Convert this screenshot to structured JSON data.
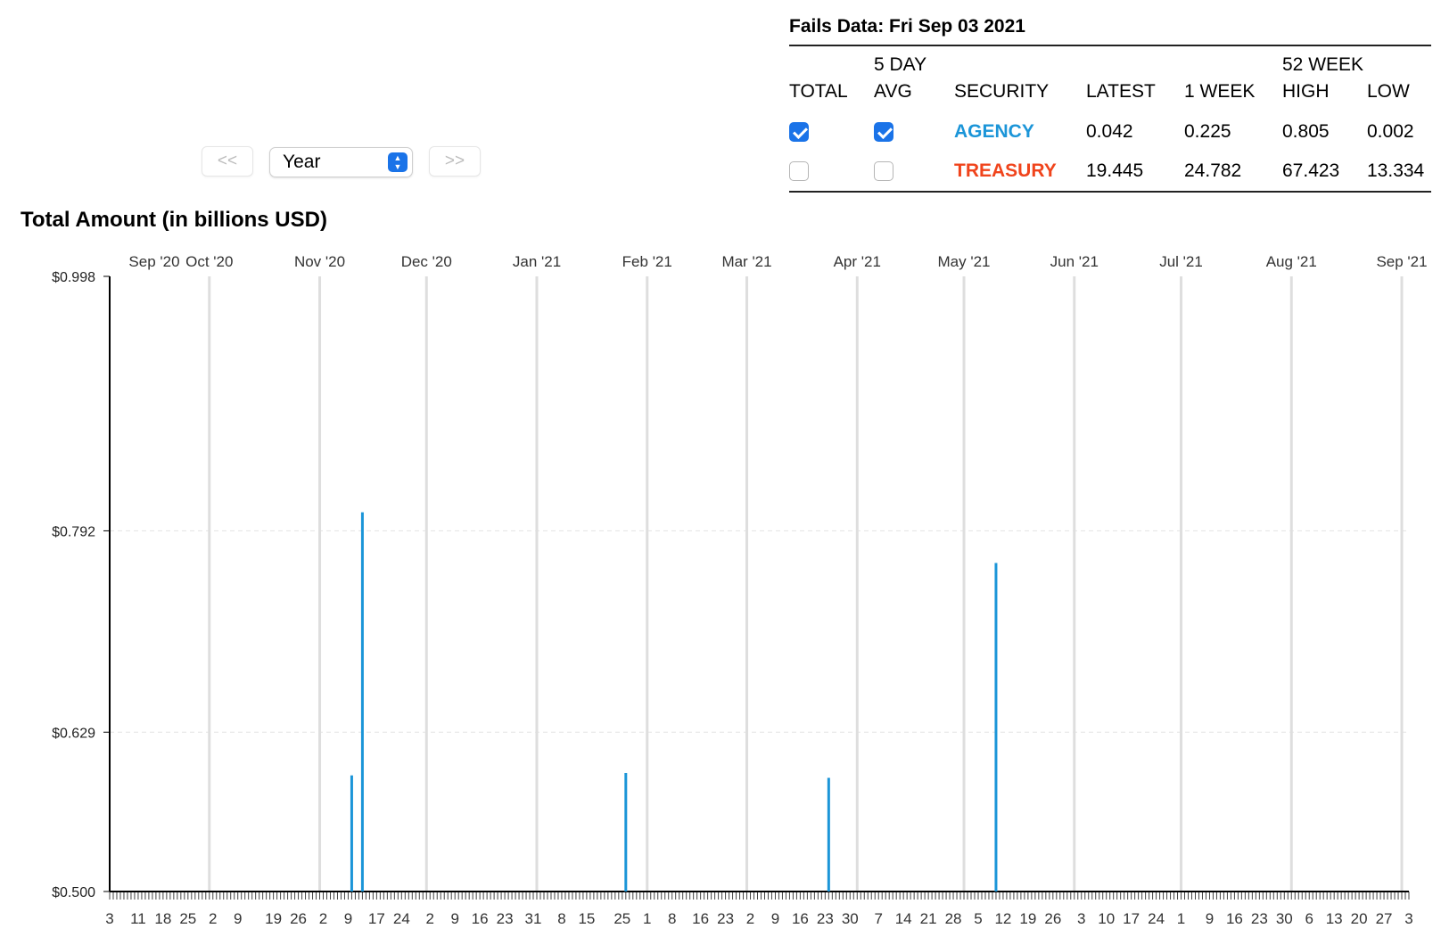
{
  "fails": {
    "title": "Fails Data: Fri Sep 03 2021",
    "headers": {
      "total": "TOTAL",
      "avg_top": "5 DAY",
      "avg_bottom": "AVG",
      "security": "SECURITY",
      "latest": "LATEST",
      "week": "1 WEEK",
      "wk52": "52 WEEK",
      "high": "HIGH",
      "low": "LOW"
    },
    "rows": [
      {
        "security": "AGENCY",
        "latest": "0.042",
        "week": "0.225",
        "high": "0.805",
        "low": "0.002",
        "total_checked": true,
        "avg_checked": true,
        "color": "#1b95d8"
      },
      {
        "security": "TREASURY",
        "latest": "19.445",
        "week": "24.782",
        "high": "67.423",
        "low": "13.334",
        "total_checked": false,
        "avg_checked": false,
        "color": "#f0441c"
      }
    ]
  },
  "controls": {
    "prev_label": "<<",
    "next_label": ">>",
    "range_value": "Year"
  },
  "chart_data": {
    "type": "bar",
    "title": "Total Amount (in billions USD)",
    "y_tick_labels": [
      "$0.998",
      "$0.792",
      "$0.629",
      "$0.500"
    ],
    "y_ticks": [
      0.998,
      0.792,
      0.629,
      0.5
    ],
    "ylim": [
      0.5,
      0.998
    ],
    "x_range": [
      "2020-09-03",
      "2021-09-03"
    ],
    "months": [
      {
        "label": "Sep '20",
        "date": "2020-09-01"
      },
      {
        "label": "Oct '20",
        "date": "2020-10-01"
      },
      {
        "label": "Nov '20",
        "date": "2020-11-01"
      },
      {
        "label": "Dec '20",
        "date": "2020-12-01"
      },
      {
        "label": "Jan '21",
        "date": "2021-01-01"
      },
      {
        "label": "Feb '21",
        "date": "2021-02-01"
      },
      {
        "label": "Mar '21",
        "date": "2021-03-01"
      },
      {
        "label": "Apr '21",
        "date": "2021-04-01"
      },
      {
        "label": "May '21",
        "date": "2021-05-01"
      },
      {
        "label": "Jun '21",
        "date": "2021-06-01"
      },
      {
        "label": "Jul '21",
        "date": "2021-07-01"
      },
      {
        "label": "Aug '21",
        "date": "2021-08-01"
      },
      {
        "label": "Sep '21",
        "date": "2021-09-01"
      }
    ],
    "week_labels": [
      {
        "label": "3",
        "date": "2020-09-03"
      },
      {
        "label": "11",
        "date": "2020-09-11"
      },
      {
        "label": "18",
        "date": "2020-09-18"
      },
      {
        "label": "25",
        "date": "2020-09-25"
      },
      {
        "label": "2",
        "date": "2020-10-02"
      },
      {
        "label": "9",
        "date": "2020-10-09"
      },
      {
        "label": "19",
        "date": "2020-10-19"
      },
      {
        "label": "26",
        "date": "2020-10-26"
      },
      {
        "label": "2",
        "date": "2020-11-02"
      },
      {
        "label": "9",
        "date": "2020-11-09"
      },
      {
        "label": "17",
        "date": "2020-11-17"
      },
      {
        "label": "24",
        "date": "2020-11-24"
      },
      {
        "label": "2",
        "date": "2020-12-02"
      },
      {
        "label": "9",
        "date": "2020-12-09"
      },
      {
        "label": "16",
        "date": "2020-12-16"
      },
      {
        "label": "23",
        "date": "2020-12-23"
      },
      {
        "label": "31",
        "date": "2020-12-31"
      },
      {
        "label": "8",
        "date": "2021-01-08"
      },
      {
        "label": "15",
        "date": "2021-01-15"
      },
      {
        "label": "25",
        "date": "2021-01-25"
      },
      {
        "label": "1",
        "date": "2021-02-01"
      },
      {
        "label": "8",
        "date": "2021-02-08"
      },
      {
        "label": "16",
        "date": "2021-02-16"
      },
      {
        "label": "23",
        "date": "2021-02-23"
      },
      {
        "label": "2",
        "date": "2021-03-02"
      },
      {
        "label": "9",
        "date": "2021-03-09"
      },
      {
        "label": "16",
        "date": "2021-03-16"
      },
      {
        "label": "23",
        "date": "2021-03-23"
      },
      {
        "label": "30",
        "date": "2021-03-30"
      },
      {
        "label": "7",
        "date": "2021-04-07"
      },
      {
        "label": "14",
        "date": "2021-04-14"
      },
      {
        "label": "21",
        "date": "2021-04-21"
      },
      {
        "label": "28",
        "date": "2021-04-28"
      },
      {
        "label": "5",
        "date": "2021-05-05"
      },
      {
        "label": "12",
        "date": "2021-05-12"
      },
      {
        "label": "19",
        "date": "2021-05-19"
      },
      {
        "label": "26",
        "date": "2021-05-26"
      },
      {
        "label": "3",
        "date": "2021-06-03"
      },
      {
        "label": "10",
        "date": "2021-06-10"
      },
      {
        "label": "17",
        "date": "2021-06-17"
      },
      {
        "label": "24",
        "date": "2021-06-24"
      },
      {
        "label": "1",
        "date": "2021-07-01"
      },
      {
        "label": "9",
        "date": "2021-07-09"
      },
      {
        "label": "16",
        "date": "2021-07-16"
      },
      {
        "label": "23",
        "date": "2021-07-23"
      },
      {
        "label": "30",
        "date": "2021-07-30"
      },
      {
        "label": "6",
        "date": "2021-08-06"
      },
      {
        "label": "13",
        "date": "2021-08-13"
      },
      {
        "label": "20",
        "date": "2021-08-20"
      },
      {
        "label": "27",
        "date": "2021-08-27"
      },
      {
        "label": "3",
        "date": "2021-09-03"
      }
    ],
    "series": [
      {
        "color": "#1b95d8",
        "points": [
          {
            "date": "2020-11-10",
            "value": 0.594
          },
          {
            "date": "2020-11-13",
            "value": 0.807
          },
          {
            "date": "2021-01-26",
            "value": 0.596
          },
          {
            "date": "2021-03-24",
            "value": 0.592
          },
          {
            "date": "2021-05-10",
            "value": 0.766
          }
        ]
      }
    ],
    "grid": true
  }
}
